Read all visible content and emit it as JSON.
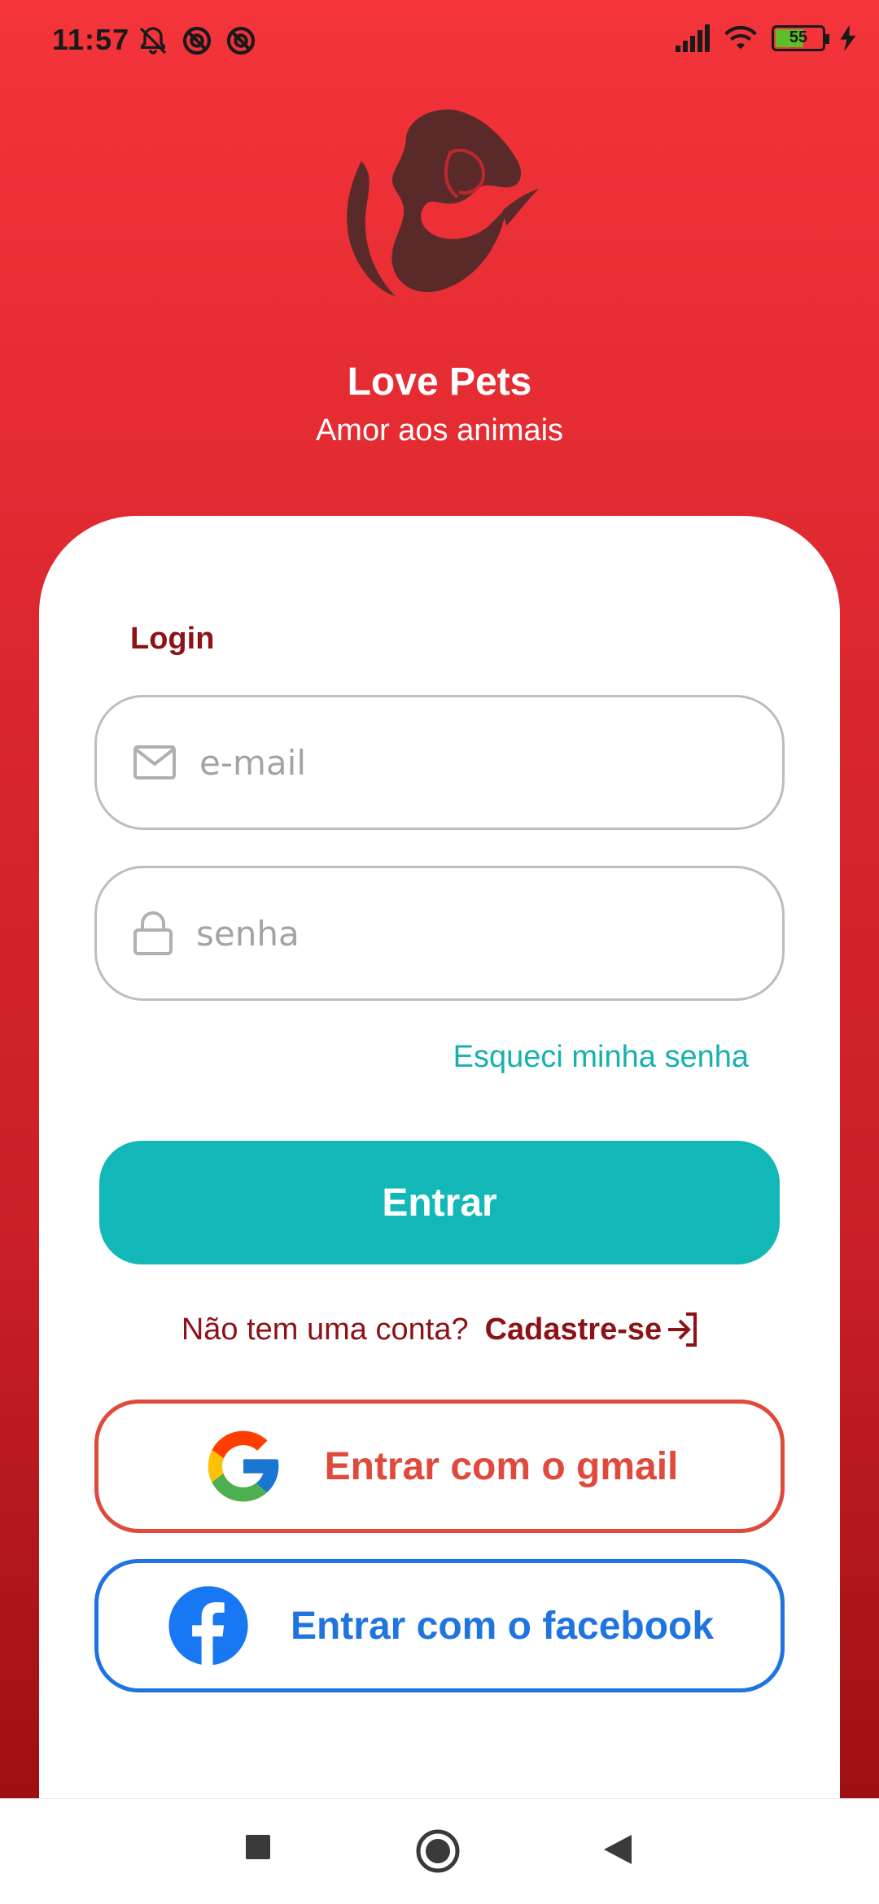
{
  "status_bar": {
    "time": "11:57",
    "battery_level": "55",
    "left_icons": [
      "notifications-off-icon",
      "blocked-icon",
      "blocked-icon"
    ],
    "right_icons": [
      "signal-icon",
      "wifi-icon",
      "battery-icon",
      "charging-icon"
    ]
  },
  "app": {
    "title": "Love Pets",
    "subtitle": "Amor aos animais"
  },
  "login": {
    "heading": "Login",
    "email_placeholder": "e-mail",
    "password_placeholder": "senha",
    "forgot_password": "Esqueci minha senha",
    "submit_label": "Entrar"
  },
  "signup": {
    "prompt": "Não tem uma conta?",
    "link_label": "Cadastre-se"
  },
  "social": {
    "google_label": "Entrar com o gmail",
    "facebook_label": "Entrar com o facebook"
  },
  "colors": {
    "primary_red": "#f4343a",
    "dark_red": "#8e1116",
    "teal": "#12b8b8",
    "google_red": "#e04a3d",
    "facebook_blue": "#1f74e0"
  }
}
